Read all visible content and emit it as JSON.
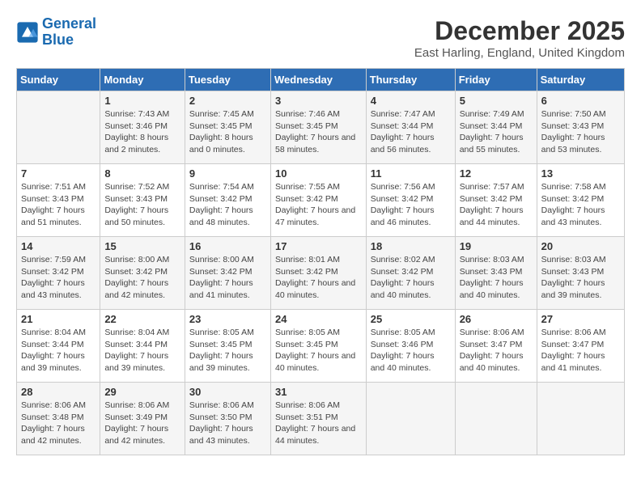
{
  "header": {
    "logo_line1": "General",
    "logo_line2": "Blue",
    "month_title": "December 2025",
    "location": "East Harling, England, United Kingdom"
  },
  "weekdays": [
    "Sunday",
    "Monday",
    "Tuesday",
    "Wednesday",
    "Thursday",
    "Friday",
    "Saturday"
  ],
  "weeks": [
    [
      {
        "day": "",
        "sunrise": "",
        "sunset": "",
        "daylight": ""
      },
      {
        "day": "1",
        "sunrise": "Sunrise: 7:43 AM",
        "sunset": "Sunset: 3:46 PM",
        "daylight": "Daylight: 8 hours and 2 minutes."
      },
      {
        "day": "2",
        "sunrise": "Sunrise: 7:45 AM",
        "sunset": "Sunset: 3:45 PM",
        "daylight": "Daylight: 8 hours and 0 minutes."
      },
      {
        "day": "3",
        "sunrise": "Sunrise: 7:46 AM",
        "sunset": "Sunset: 3:45 PM",
        "daylight": "Daylight: 7 hours and 58 minutes."
      },
      {
        "day": "4",
        "sunrise": "Sunrise: 7:47 AM",
        "sunset": "Sunset: 3:44 PM",
        "daylight": "Daylight: 7 hours and 56 minutes."
      },
      {
        "day": "5",
        "sunrise": "Sunrise: 7:49 AM",
        "sunset": "Sunset: 3:44 PM",
        "daylight": "Daylight: 7 hours and 55 minutes."
      },
      {
        "day": "6",
        "sunrise": "Sunrise: 7:50 AM",
        "sunset": "Sunset: 3:43 PM",
        "daylight": "Daylight: 7 hours and 53 minutes."
      }
    ],
    [
      {
        "day": "7",
        "sunrise": "Sunrise: 7:51 AM",
        "sunset": "Sunset: 3:43 PM",
        "daylight": "Daylight: 7 hours and 51 minutes."
      },
      {
        "day": "8",
        "sunrise": "Sunrise: 7:52 AM",
        "sunset": "Sunset: 3:43 PM",
        "daylight": "Daylight: 7 hours and 50 minutes."
      },
      {
        "day": "9",
        "sunrise": "Sunrise: 7:54 AM",
        "sunset": "Sunset: 3:42 PM",
        "daylight": "Daylight: 7 hours and 48 minutes."
      },
      {
        "day": "10",
        "sunrise": "Sunrise: 7:55 AM",
        "sunset": "Sunset: 3:42 PM",
        "daylight": "Daylight: 7 hours and 47 minutes."
      },
      {
        "day": "11",
        "sunrise": "Sunrise: 7:56 AM",
        "sunset": "Sunset: 3:42 PM",
        "daylight": "Daylight: 7 hours and 46 minutes."
      },
      {
        "day": "12",
        "sunrise": "Sunrise: 7:57 AM",
        "sunset": "Sunset: 3:42 PM",
        "daylight": "Daylight: 7 hours and 44 minutes."
      },
      {
        "day": "13",
        "sunrise": "Sunrise: 7:58 AM",
        "sunset": "Sunset: 3:42 PM",
        "daylight": "Daylight: 7 hours and 43 minutes."
      }
    ],
    [
      {
        "day": "14",
        "sunrise": "Sunrise: 7:59 AM",
        "sunset": "Sunset: 3:42 PM",
        "daylight": "Daylight: 7 hours and 43 minutes."
      },
      {
        "day": "15",
        "sunrise": "Sunrise: 8:00 AM",
        "sunset": "Sunset: 3:42 PM",
        "daylight": "Daylight: 7 hours and 42 minutes."
      },
      {
        "day": "16",
        "sunrise": "Sunrise: 8:00 AM",
        "sunset": "Sunset: 3:42 PM",
        "daylight": "Daylight: 7 hours and 41 minutes."
      },
      {
        "day": "17",
        "sunrise": "Sunrise: 8:01 AM",
        "sunset": "Sunset: 3:42 PM",
        "daylight": "Daylight: 7 hours and 40 minutes."
      },
      {
        "day": "18",
        "sunrise": "Sunrise: 8:02 AM",
        "sunset": "Sunset: 3:42 PM",
        "daylight": "Daylight: 7 hours and 40 minutes."
      },
      {
        "day": "19",
        "sunrise": "Sunrise: 8:03 AM",
        "sunset": "Sunset: 3:43 PM",
        "daylight": "Daylight: 7 hours and 40 minutes."
      },
      {
        "day": "20",
        "sunrise": "Sunrise: 8:03 AM",
        "sunset": "Sunset: 3:43 PM",
        "daylight": "Daylight: 7 hours and 39 minutes."
      }
    ],
    [
      {
        "day": "21",
        "sunrise": "Sunrise: 8:04 AM",
        "sunset": "Sunset: 3:44 PM",
        "daylight": "Daylight: 7 hours and 39 minutes."
      },
      {
        "day": "22",
        "sunrise": "Sunrise: 8:04 AM",
        "sunset": "Sunset: 3:44 PM",
        "daylight": "Daylight: 7 hours and 39 minutes."
      },
      {
        "day": "23",
        "sunrise": "Sunrise: 8:05 AM",
        "sunset": "Sunset: 3:45 PM",
        "daylight": "Daylight: 7 hours and 39 minutes."
      },
      {
        "day": "24",
        "sunrise": "Sunrise: 8:05 AM",
        "sunset": "Sunset: 3:45 PM",
        "daylight": "Daylight: 7 hours and 40 minutes."
      },
      {
        "day": "25",
        "sunrise": "Sunrise: 8:05 AM",
        "sunset": "Sunset: 3:46 PM",
        "daylight": "Daylight: 7 hours and 40 minutes."
      },
      {
        "day": "26",
        "sunrise": "Sunrise: 8:06 AM",
        "sunset": "Sunset: 3:47 PM",
        "daylight": "Daylight: 7 hours and 40 minutes."
      },
      {
        "day": "27",
        "sunrise": "Sunrise: 8:06 AM",
        "sunset": "Sunset: 3:47 PM",
        "daylight": "Daylight: 7 hours and 41 minutes."
      }
    ],
    [
      {
        "day": "28",
        "sunrise": "Sunrise: 8:06 AM",
        "sunset": "Sunset: 3:48 PM",
        "daylight": "Daylight: 7 hours and 42 minutes."
      },
      {
        "day": "29",
        "sunrise": "Sunrise: 8:06 AM",
        "sunset": "Sunset: 3:49 PM",
        "daylight": "Daylight: 7 hours and 42 minutes."
      },
      {
        "day": "30",
        "sunrise": "Sunrise: 8:06 AM",
        "sunset": "Sunset: 3:50 PM",
        "daylight": "Daylight: 7 hours and 43 minutes."
      },
      {
        "day": "31",
        "sunrise": "Sunrise: 8:06 AM",
        "sunset": "Sunset: 3:51 PM",
        "daylight": "Daylight: 7 hours and 44 minutes."
      },
      {
        "day": "",
        "sunrise": "",
        "sunset": "",
        "daylight": ""
      },
      {
        "day": "",
        "sunrise": "",
        "sunset": "",
        "daylight": ""
      },
      {
        "day": "",
        "sunrise": "",
        "sunset": "",
        "daylight": ""
      }
    ]
  ]
}
